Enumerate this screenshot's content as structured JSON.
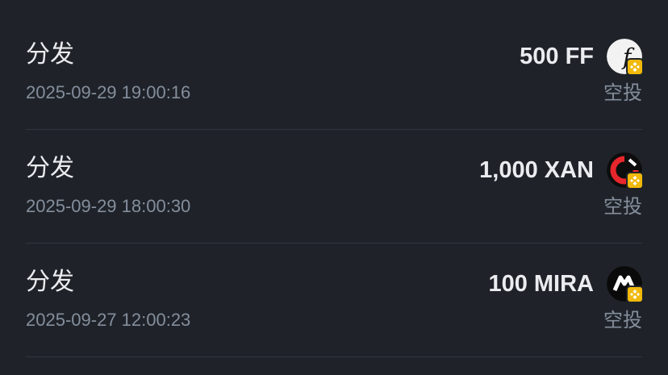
{
  "records": [
    {
      "title": "分发",
      "time": "2025-09-29 19:00:16",
      "amount": "500 FF",
      "tag": "空投",
      "token_icon": "ff-token-icon",
      "badge_icon": "bnb-chain-badge-icon"
    },
    {
      "title": "分发",
      "time": "2025-09-29 18:00:30",
      "amount": "1,000 XAN",
      "tag": "空投",
      "token_icon": "xan-token-icon",
      "badge_icon": "bnb-chain-badge-icon"
    },
    {
      "title": "分发",
      "time": "2025-09-27 12:00:23",
      "amount": "100 MIRA",
      "tag": "空投",
      "token_icon": "mira-token-icon",
      "badge_icon": "bnb-chain-badge-icon"
    }
  ],
  "colors": {
    "background": "#1f2329",
    "primary_text": "#eaecef",
    "secondary_text": "#848e9c",
    "divider": "#2f353e",
    "badge": "#f0b90b"
  }
}
